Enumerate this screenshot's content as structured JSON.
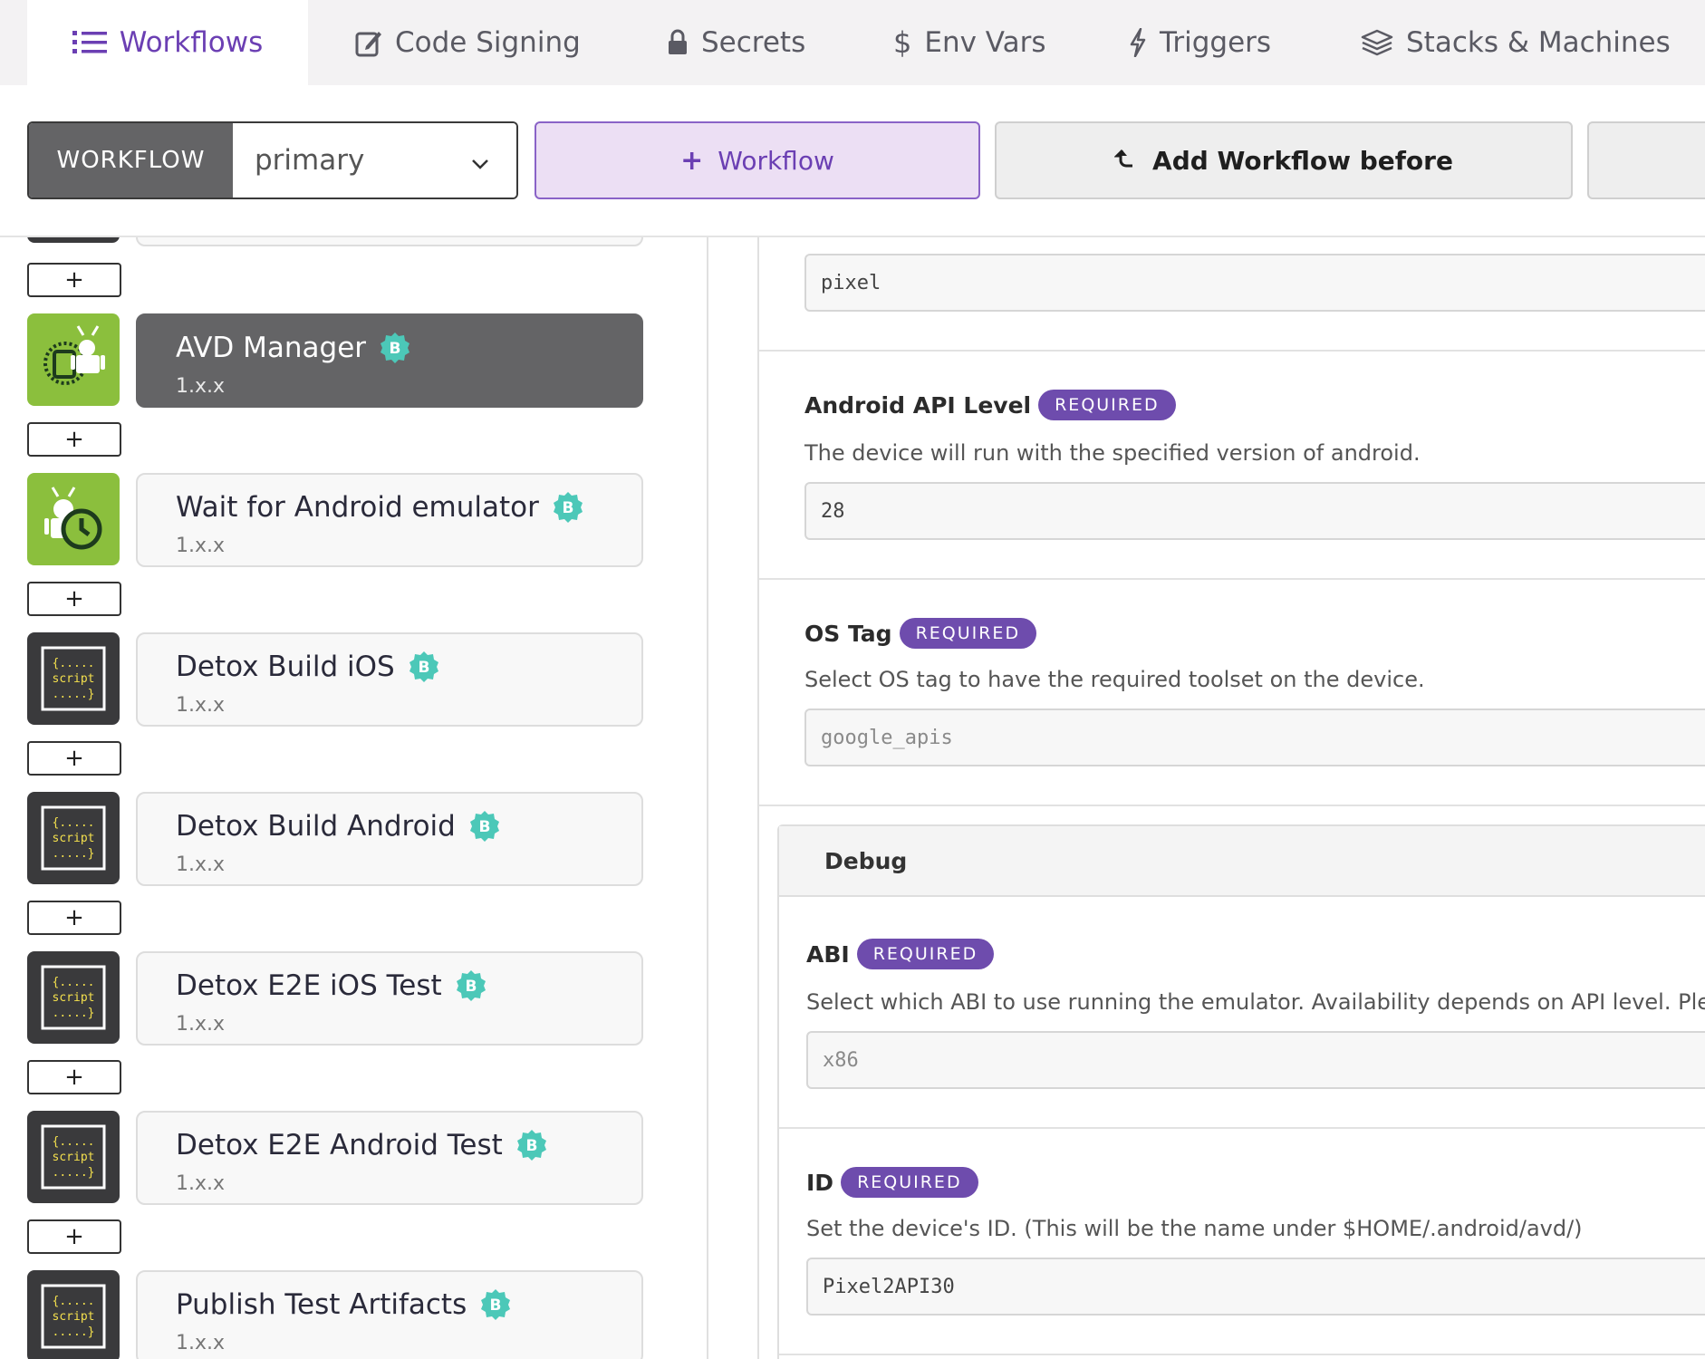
{
  "tabs": [
    {
      "label": "Workflows",
      "icon": "list-icon",
      "active": true
    },
    {
      "label": "Code Signing",
      "icon": "edit-icon",
      "active": false
    },
    {
      "label": "Secrets",
      "icon": "lock-icon",
      "active": false
    },
    {
      "label": "Env Vars",
      "icon": "dollar-icon",
      "active": false
    },
    {
      "label": "Triggers",
      "icon": "bolt-icon",
      "active": false
    },
    {
      "label": "Stacks & Machines",
      "icon": "layers-icon",
      "active": false
    }
  ],
  "toolbar": {
    "workflow_label": "WORKFLOW",
    "workflow_value": "primary",
    "add_workflow_label": "Workflow",
    "add_before_label": "Add Workflow before"
  },
  "steps": [
    {
      "title": "AVD Manager",
      "version": "1.x.x",
      "icon": "avd-manager-icon",
      "selected": true
    },
    {
      "title": "Wait for Android emulator",
      "version": "1.x.x",
      "icon": "android-wait-icon",
      "selected": false
    },
    {
      "title": "Detox Build iOS",
      "version": "1.x.x",
      "icon": "script-icon",
      "selected": false
    },
    {
      "title": "Detox Build Android",
      "version": "1.x.x",
      "icon": "script-icon",
      "selected": false
    },
    {
      "title": "Detox E2E iOS Test",
      "version": "1.x.x",
      "icon": "script-icon",
      "selected": false
    },
    {
      "title": "Detox E2E Android Test",
      "version": "1.x.x",
      "icon": "script-icon",
      "selected": false
    },
    {
      "title": "Publish Test Artifacts",
      "version": "1.x.x",
      "icon": "script-icon",
      "selected": false
    }
  ],
  "add_step_label": "+",
  "badge_letter": "B",
  "script_icon_text": {
    "top": "{.....",
    "mid": "script",
    "bot": ".....}"
  },
  "inputs": {
    "top_value": "pixel",
    "required_label": "REQUIRED",
    "api_level": {
      "title": "Android API Level",
      "desc": "The device will run with the specified version of android.",
      "value": "28"
    },
    "os_tag": {
      "title": "OS Tag",
      "desc": "Select OS tag to have the required toolset on the device.",
      "value": "google_apis"
    },
    "debug_section": "Debug",
    "abi": {
      "title": "ABI",
      "desc": "Select which ABI to use running the emulator. Availability depends on API level. Pleas",
      "value": "x86"
    },
    "id": {
      "title": "ID",
      "desc": "Set the device's ID. (This will be the name under $HOME/.android/avd/)",
      "value": "Pixel2API30"
    }
  },
  "colors": {
    "accent": "#6b3fb3",
    "badge": "#4cc8b8",
    "required": "#6e4cad",
    "selected_step": "#646466"
  }
}
